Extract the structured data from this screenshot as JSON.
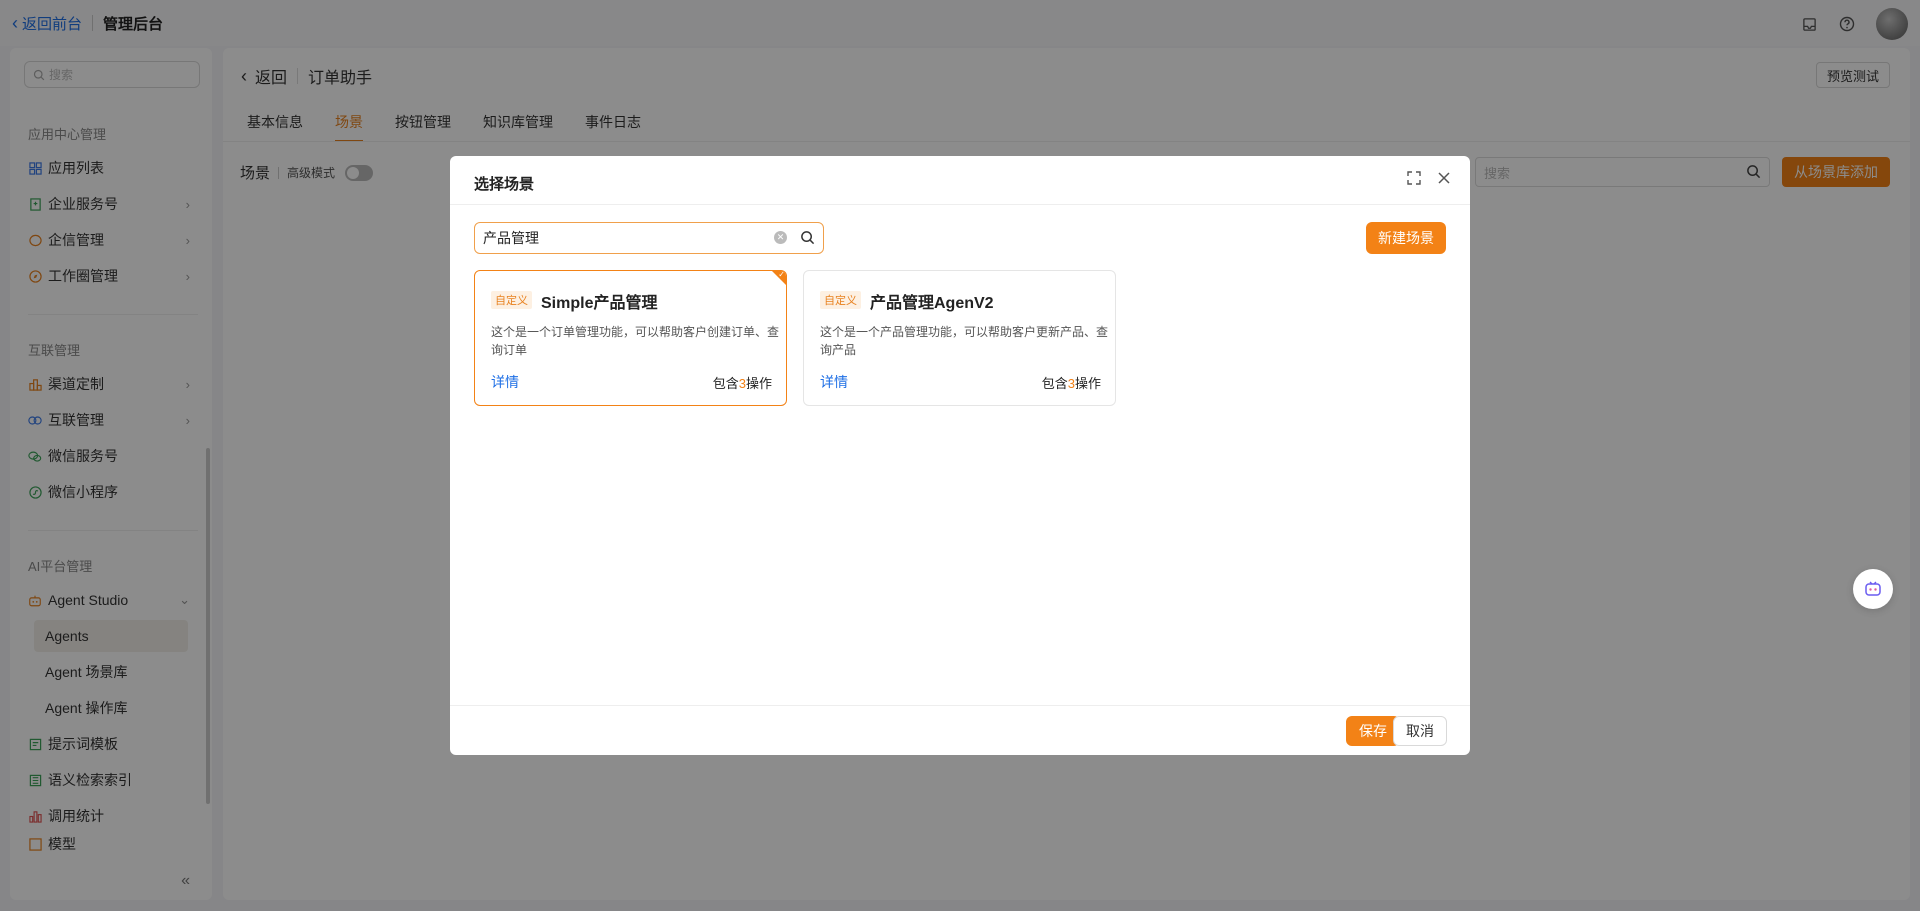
{
  "topbar": {
    "back_front": "返回前台",
    "admin_title": "管理后台",
    "icons": [
      "inbox-icon",
      "help-icon",
      "avatar"
    ]
  },
  "sidebar": {
    "search_placeholder": "搜索",
    "groups": [
      {
        "title": "应用中心管理",
        "items": [
          {
            "label": "应用列表",
            "icon": "grid-icon",
            "expandable": false
          },
          {
            "label": "企业服务号",
            "icon": "service-icon",
            "expandable": true
          },
          {
            "label": "企信管理",
            "icon": "chat-icon",
            "expandable": true
          },
          {
            "label": "工作圈管理",
            "icon": "compass-icon",
            "expandable": true
          }
        ]
      },
      {
        "title": "互联管理",
        "items": [
          {
            "label": "渠道定制",
            "icon": "channel-icon",
            "expandable": true
          },
          {
            "label": "互联管理",
            "icon": "link-icon",
            "expandable": true
          },
          {
            "label": "微信服务号",
            "icon": "wechat-icon",
            "expandable": false
          },
          {
            "label": "微信小程序",
            "icon": "miniprogram-icon",
            "expandable": false
          }
        ]
      },
      {
        "title": "AI平台管理",
        "items": [
          {
            "label": "Agent Studio",
            "icon": "robot-icon",
            "expandable": true,
            "expanded": true
          },
          {
            "label": "提示词模板",
            "icon": "template-icon",
            "expandable": false
          },
          {
            "label": "语义检索索引",
            "icon": "index-icon",
            "expandable": false
          },
          {
            "label": "调用统计",
            "icon": "stats-icon",
            "expandable": false
          },
          {
            "label": "模型",
            "icon": "model-icon",
            "expandable": false
          }
        ],
        "sub_items": [
          {
            "label": "Agents",
            "active": true
          },
          {
            "label": "Agent 场景库",
            "active": false
          },
          {
            "label": "Agent 操作库",
            "active": false
          }
        ]
      }
    ]
  },
  "main": {
    "back_label": "返回",
    "page_title": "订单助手",
    "preview_label": "预览测试",
    "tabs": [
      {
        "label": "基本信息",
        "active": false
      },
      {
        "label": "场景",
        "active": true
      },
      {
        "label": "按钮管理",
        "active": false
      },
      {
        "label": "知识库管理",
        "active": false
      },
      {
        "label": "事件日志",
        "active": false
      }
    ],
    "scene_label": "场景",
    "advanced_mode": "高级模式",
    "search_placeholder": "搜索",
    "add_from_lib": "从场景库添加"
  },
  "modal": {
    "title": "选择场景",
    "search_value": "产品管理",
    "new_scene": "新建场景",
    "cards": [
      {
        "badge": "自定义",
        "title": "Simple产品管理",
        "desc": "这个是一个订单管理功能，可以帮助客户创建订单、查询订单",
        "detail": "详情",
        "ops_prefix": "包含",
        "ops_count": "3",
        "ops_suffix": "操作",
        "selected": true
      },
      {
        "badge": "自定义",
        "title": "产品管理AgenV2",
        "desc": "这个是一个产品管理功能，可以帮助客户更新产品、查询产品",
        "detail": "详情",
        "ops_prefix": "包含",
        "ops_count": "3",
        "ops_suffix": "操作",
        "selected": false
      }
    ],
    "save": "保存",
    "cancel": "取消"
  },
  "colors": {
    "accent": "#f38216",
    "link": "#1f6fe5"
  }
}
